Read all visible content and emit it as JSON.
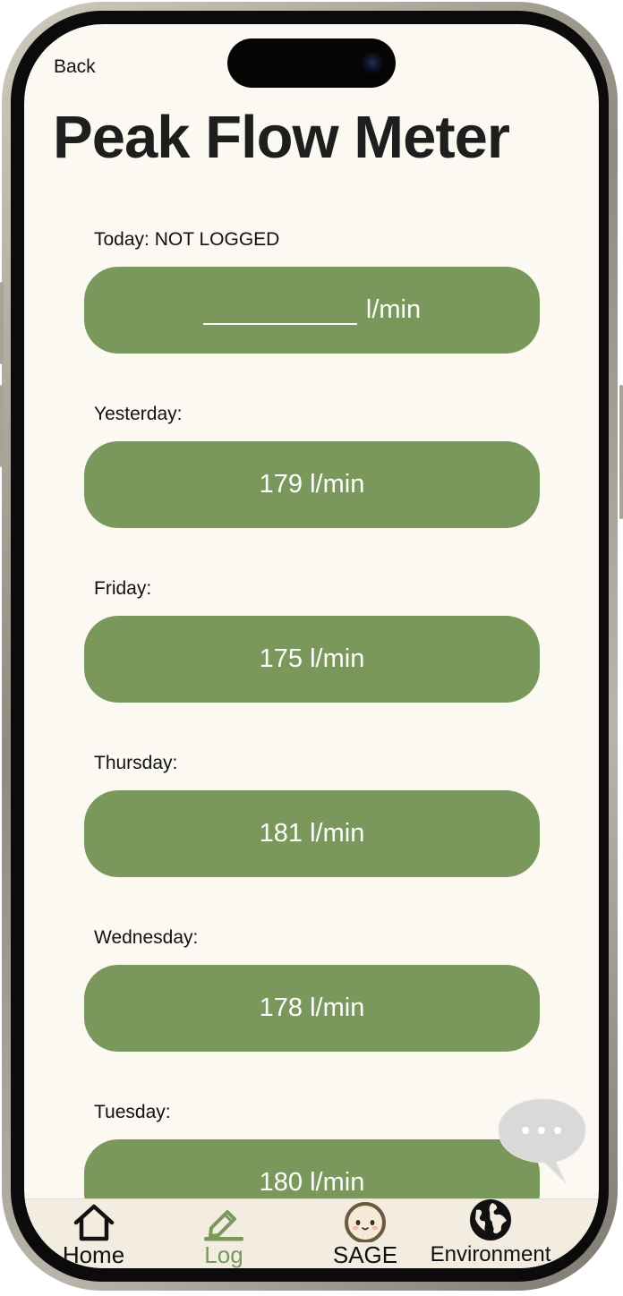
{
  "header": {
    "back_label": "Back",
    "title": "Peak Flow Meter"
  },
  "log": {
    "unit_suffix": "l/min",
    "today": {
      "label": "Today: NOT LOGGED",
      "input_value": "",
      "unit": "l/min"
    },
    "entries": [
      {
        "label": "Yesterday:",
        "value": "179 l/min"
      },
      {
        "label": "Friday:",
        "value": "175 l/min"
      },
      {
        "label": "Thursday:",
        "value": "181 l/min"
      },
      {
        "label": "Wednesday:",
        "value": "178 l/min"
      },
      {
        "label": "Tuesday:",
        "value": "180 l/min"
      }
    ]
  },
  "tabs": [
    {
      "label": "Home",
      "icon": "home-icon",
      "active": false
    },
    {
      "label": "Log",
      "icon": "pencil-icon",
      "active": true
    },
    {
      "label": "SAGE",
      "icon": "sage-face-icon",
      "active": false
    },
    {
      "label": "Environment",
      "icon": "globe-icon",
      "active": false
    }
  ],
  "colors": {
    "accent_green": "#7a975c",
    "background": "#fcf9f3",
    "tabbar": "#f3ede1",
    "title_text": "#1e1e1e"
  }
}
